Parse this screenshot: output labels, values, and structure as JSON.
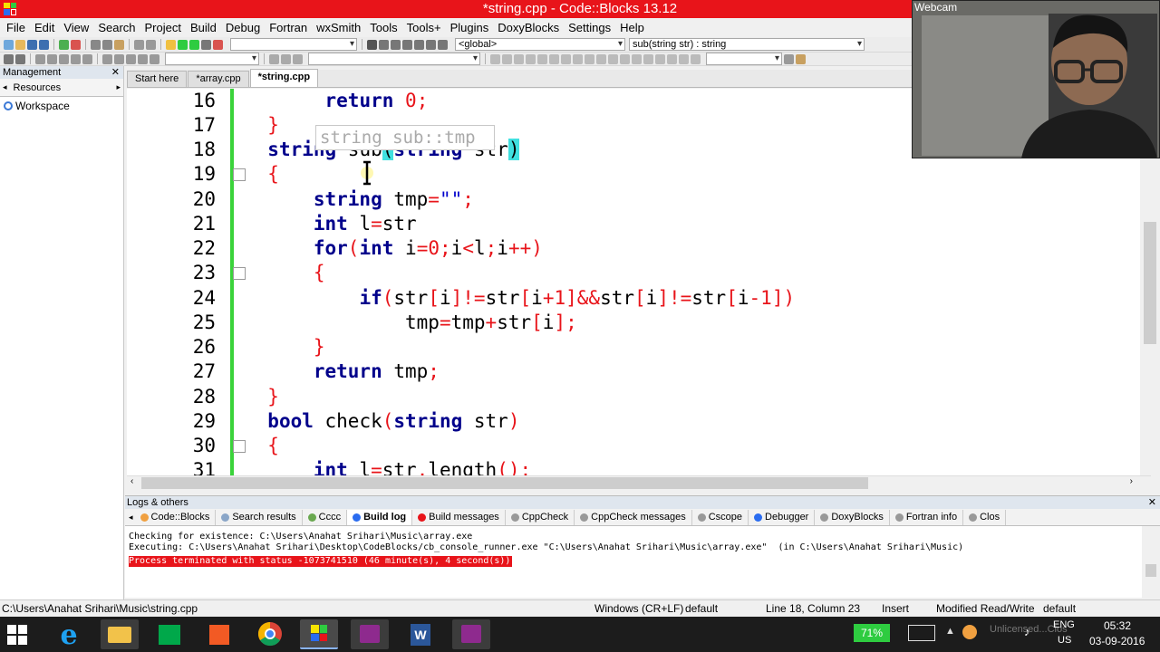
{
  "window": {
    "title": "*string.cpp - Code::Blocks 13.12"
  },
  "menu": [
    "File",
    "Edit",
    "View",
    "Search",
    "Project",
    "Build",
    "Debug",
    "Fortran",
    "wxSmith",
    "Tools",
    "Tools+",
    "Plugins",
    "DoxyBlocks",
    "Settings",
    "Help"
  ],
  "toolbar": {
    "scope": "<global>",
    "function": "sub(string str) : string"
  },
  "management": {
    "title": "Management",
    "tab": "Resources",
    "workspace": "Workspace"
  },
  "editor_tabs": [
    "Start here",
    "*array.cpp",
    "*string.cpp"
  ],
  "editor": {
    "line_numbers": [
      "16",
      "17",
      "18",
      "19",
      "20",
      "21",
      "22",
      "23",
      "24",
      "25",
      "26",
      "27",
      "28",
      "29",
      "30",
      "31"
    ],
    "tooltip": "string sub::tmp"
  },
  "logs": {
    "title": "Logs & others",
    "tabs": [
      "Code::Blocks",
      "Search results",
      "Cccc",
      "Build log",
      "Build messages",
      "CppCheck",
      "CppCheck messages",
      "Cscope",
      "Debugger",
      "DoxyBlocks",
      "Fortran info",
      "Clos"
    ],
    "lines": [
      "Checking for existence: C:\\Users\\Anahat Srihari\\Music\\array.exe",
      "Executing: C:\\Users\\Anahat Srihari\\Desktop\\CodeBlocks/cb_console_runner.exe \"C:\\Users\\Anahat Srihari\\Music\\array.exe\"  (in C:\\Users\\Anahat Srihari\\Music)"
    ],
    "error_line": "Process terminated with status -1073741510 (46 minute(s), 4 second(s))"
  },
  "status": {
    "path": "C:\\Users\\Anahat Srihari\\Music\\string.cpp",
    "eol": "Windows (CR+LF)",
    "encoding": "default",
    "position": "Line 18, Column 23",
    "mode": "Insert",
    "access": "Modified Read/Write",
    "extra": "default"
  },
  "webcam": {
    "label": "Webcam"
  },
  "taskbar": {
    "battery": "71%",
    "lang": "ENG",
    "region": "US",
    "time": "05:32",
    "date": "03-09-2016",
    "watermark": "Unlicensed...Clos"
  }
}
